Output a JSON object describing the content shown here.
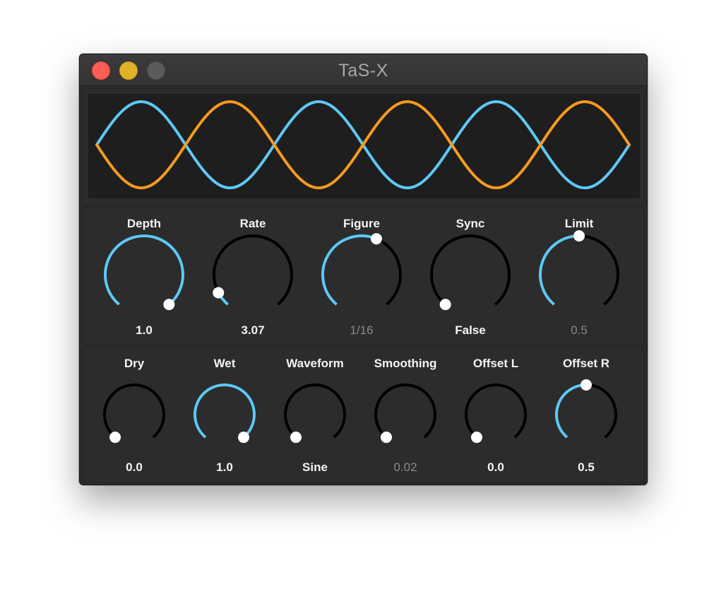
{
  "window": {
    "title": "TaS-X"
  },
  "colors": {
    "accent_blue": "#5ec8f5",
    "accent_orange": "#f59a21",
    "track": "#000000",
    "handle": "#ffffff"
  },
  "scope": {
    "series": [
      {
        "color": "#5ec8f5",
        "cycles": 3,
        "phase": 0
      },
      {
        "color": "#f59a21",
        "cycles": 3,
        "phase": 180
      }
    ]
  },
  "row1": [
    {
      "name": "depth",
      "label": "Depth",
      "value": "1.0",
      "level": 1.0,
      "dim": false
    },
    {
      "name": "rate",
      "label": "Rate",
      "value": "3.07",
      "level": 0.08,
      "dim": false
    },
    {
      "name": "figure",
      "label": "Figure",
      "value": "1/16",
      "level": 0.58,
      "dim": true
    },
    {
      "name": "sync",
      "label": "Sync",
      "value": "False",
      "level": 0.0,
      "dim": false
    },
    {
      "name": "limit",
      "label": "Limit",
      "value": "0.5",
      "level": 0.5,
      "dim": true
    }
  ],
  "row2": [
    {
      "name": "dry",
      "label": "Dry",
      "value": "0.0",
      "level": 0.0,
      "dim": false
    },
    {
      "name": "wet",
      "label": "Wet",
      "value": "1.0",
      "level": 1.0,
      "dim": false
    },
    {
      "name": "waveform",
      "label": "Waveform",
      "value": "Sine",
      "level": 0.0,
      "dim": false
    },
    {
      "name": "smoothing",
      "label": "Smoothing",
      "value": "0.02",
      "level": 0.0,
      "dim": true
    },
    {
      "name": "offset-l",
      "label": "Offset L",
      "value": "0.0",
      "level": 0.0,
      "dim": false
    },
    {
      "name": "offset-r",
      "label": "Offset R",
      "value": "0.5",
      "level": 0.5,
      "dim": false
    }
  ]
}
